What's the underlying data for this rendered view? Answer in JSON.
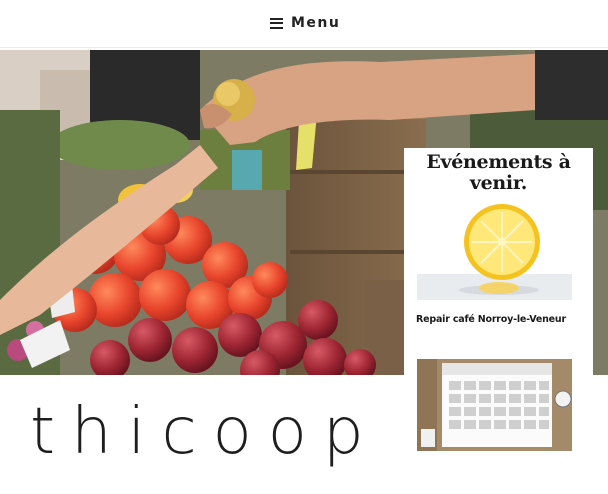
{
  "header": {
    "menu_label": "Menu"
  },
  "hero": {
    "scene": "hands exchanging an apple over a fruit market stall"
  },
  "site": {
    "logo_text": "thicoop"
  },
  "events": {
    "title": "Evénements à venir.",
    "items": [
      {
        "title": "Repair café Norroy-le-Veneur",
        "thumb": "lemon-image"
      },
      {
        "title": "",
        "thumb": "calendar-image"
      }
    ]
  },
  "colors": {
    "text": "#1e1e1e",
    "background": "#ffffff"
  }
}
